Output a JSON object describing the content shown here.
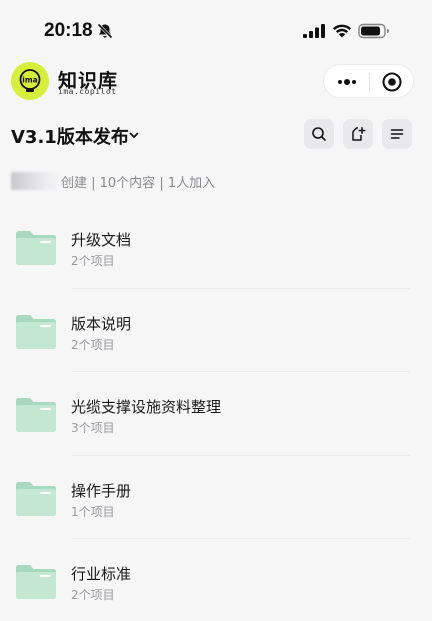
{
  "status_bar": {
    "time": "20:18"
  },
  "app": {
    "name": "知识库",
    "subtitle": "ima.copilot",
    "logo_text": "ima",
    "accent_color": "#d6ef3b"
  },
  "knowledge_base": {
    "title": "V3.1版本发布",
    "meta": "创建 | 10个内容 | 1人加入"
  },
  "folders": [
    {
      "name": "升级文档",
      "count": "2个项目"
    },
    {
      "name": "版本说明",
      "count": "2个项目"
    },
    {
      "name": "光缆支撑设施资料整理",
      "count": "3个项目"
    },
    {
      "name": "操作手册",
      "count": "1个项目"
    },
    {
      "name": "行业标准",
      "count": "2个项目"
    }
  ],
  "icons": {
    "status": [
      "bell-off-icon",
      "signal-icon",
      "wifi-icon",
      "battery-icon"
    ],
    "capsule": [
      "more-icon",
      "target-icon"
    ],
    "toolbar": [
      "search-icon",
      "add-file-icon",
      "menu-icon"
    ],
    "folder": "folder-icon"
  }
}
